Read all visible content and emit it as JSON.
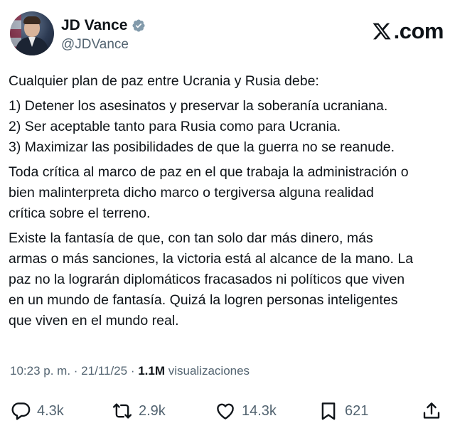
{
  "author": {
    "name": "JD Vance",
    "handle": "@JDVance",
    "verified": true,
    "verified_color": "#829aab"
  },
  "brand": {
    "domain": ".com",
    "logo_icon": "x-logo"
  },
  "tweet": {
    "intro": "Cualquier plan de paz entre Ucrania y Rusia debe:",
    "points": [
      "1) Detener los asesinatos y preservar la soberanía ucraniana.",
      "2) Ser aceptable tanto para Rusia como para Ucrania.",
      "3) Maximizar las posibilidades de que la guerra no se reanude."
    ],
    "para2_lines": [
      "Toda crítica al marco de paz en el que trabaja la administración o",
      "bien malinterpreta dicho marco o tergiversa alguna realidad",
      "crítica sobre el terreno."
    ],
    "para3_lines": [
      "Existe la fantasía de que, con tan solo dar más dinero, más",
      "armas o más sanciones, la victoria está al alcance de la mano. La",
      "paz no la lograrán diplomáticos fracasados ni políticos que viven",
      "en un mundo de fantasía. Quizá la logren personas inteligentes",
      "que viven en el mundo real."
    ]
  },
  "meta": {
    "time": "10:23 p. m.",
    "separator": " · ",
    "date": "21/11/25",
    "separator2": " · ",
    "views_count": "1.1M",
    "views_label": " visualizaciones"
  },
  "actions": {
    "reply": {
      "icon": "reply-icon",
      "count": "4.3k"
    },
    "repost": {
      "icon": "repost-icon",
      "count": "2.9k"
    },
    "like": {
      "icon": "heart-icon",
      "count": "14.3k"
    },
    "bookmark": {
      "icon": "bookmark-icon",
      "count": "621"
    },
    "share": {
      "icon": "share-icon"
    }
  },
  "colors": {
    "text": "#0f1419",
    "secondary": "#536471"
  }
}
